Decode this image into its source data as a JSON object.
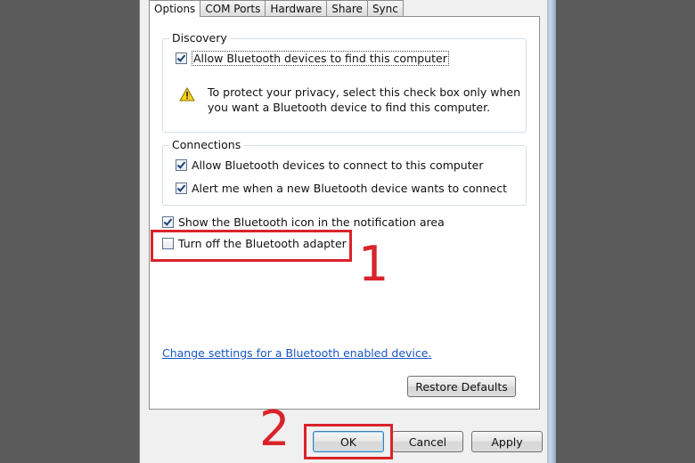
{
  "tabs": [
    {
      "label": "Options",
      "active": true
    },
    {
      "label": "COM Ports",
      "active": false
    },
    {
      "label": "Hardware",
      "active": false
    },
    {
      "label": "Share",
      "active": false
    },
    {
      "label": "Sync",
      "active": false
    }
  ],
  "discovery": {
    "title": "Discovery",
    "allow_find": {
      "label": "Allow Bluetooth devices to find this computer",
      "checked": true
    },
    "warning_icon": "warning-triangle-icon",
    "warning_line1": "To protect your privacy, select this check box only when",
    "warning_line2": "you want a Bluetooth device to find this computer."
  },
  "connections": {
    "title": "Connections",
    "allow_connect": {
      "label": "Allow Bluetooth devices to connect to this computer",
      "checked": true
    },
    "alert_new": {
      "label": "Alert me when a new Bluetooth device wants to connect",
      "checked": true
    }
  },
  "show_icon": {
    "label": "Show the Bluetooth icon in the notification area",
    "checked": true
  },
  "turn_off_adapter": {
    "label": "Turn off the Bluetooth adapter",
    "checked": false
  },
  "change_settings_link": "Change settings for a Bluetooth enabled device.",
  "buttons": {
    "restore_defaults": "Restore Defaults",
    "ok": "OK",
    "cancel": "Cancel",
    "apply": "Apply"
  },
  "annotations": {
    "step1": "1",
    "step2": "2"
  },
  "colors": {
    "highlight": "#d9232a",
    "link": "#1a57c6"
  }
}
